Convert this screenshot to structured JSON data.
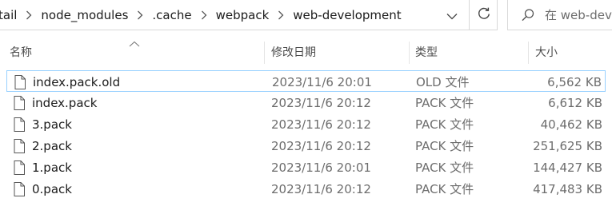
{
  "breadcrumbs": [
    {
      "label": "tail"
    },
    {
      "label": "node_modules"
    },
    {
      "label": ".cache"
    },
    {
      "label": "webpack"
    },
    {
      "label": "web-development"
    }
  ],
  "search": {
    "placeholder": "在 web-dev"
  },
  "columns": {
    "name": "名称",
    "date": "修改日期",
    "type": "类型",
    "size": "大小"
  },
  "files": [
    {
      "name": "index.pack.old",
      "date": "2023/11/6 20:01",
      "type": "OLD 文件",
      "size": "6,562 KB",
      "selected": true
    },
    {
      "name": "index.pack",
      "date": "2023/11/6 20:12",
      "type": "PACK 文件",
      "size": "6,612 KB"
    },
    {
      "name": "3.pack",
      "date": "2023/11/6 20:12",
      "type": "PACK 文件",
      "size": "40,462 KB"
    },
    {
      "name": "2.pack",
      "date": "2023/11/6 20:12",
      "type": "PACK 文件",
      "size": "251,625 KB"
    },
    {
      "name": "1.pack",
      "date": "2023/11/6 20:01",
      "type": "PACK 文件",
      "size": "144,427 KB"
    },
    {
      "name": "0.pack",
      "date": "2023/11/6 20:12",
      "type": "PACK 文件",
      "size": "417,483 KB"
    }
  ],
  "colors": {
    "selection_border": "#99d1ff",
    "secondary_text": "#6d6d6d"
  },
  "icons": [
    "chevron-right-icon",
    "chevron-down-icon",
    "refresh-icon",
    "search-icon",
    "file-icon",
    "sort-up-icon"
  ]
}
